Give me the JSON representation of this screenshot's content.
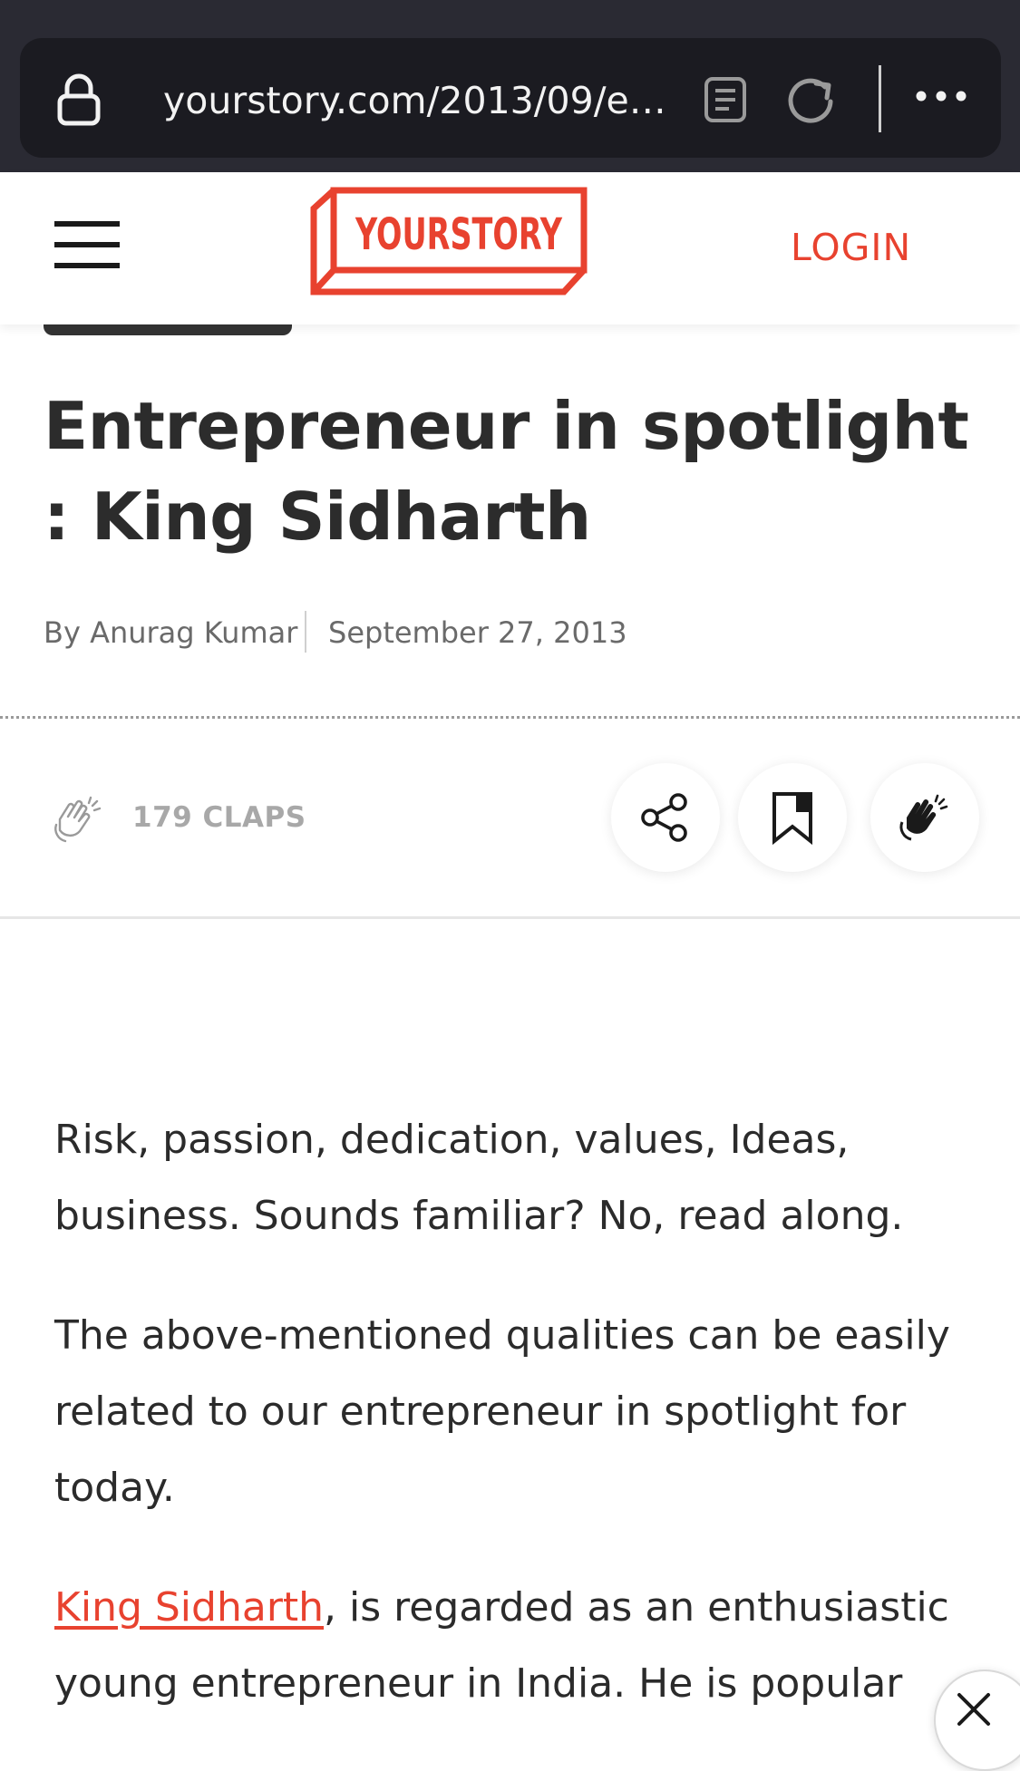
{
  "browser": {
    "url": "yourstory.com/2013/09/ent..."
  },
  "header": {
    "logo_text": "YOURSTORY",
    "login_label": "LOGIN"
  },
  "article": {
    "title": "Entrepreneur in spotlight : King Sidharth",
    "author": "By Anurag Kumar",
    "date": "September 27, 2013",
    "claps_label": "179 CLAPS",
    "paragraphs": [
      "Risk, passion, dedication, values, Ideas, business. Sounds familiar? No, read along.",
      "The above-mentioned qualities can be easily related to our entrepreneur in spotlight for today."
    ],
    "third_paragraph": {
      "link_text": "King Sidharth",
      "rest": ", is regarded as an enthusiastic young entrepreneur in India. He is popular"
    }
  },
  "icons": {
    "lock": "lock-icon",
    "reader": "reader-view-icon",
    "reload": "reload-icon",
    "more": "more-icon",
    "menu": "hamburger-menu-icon",
    "claps": "clapping-hands-icon",
    "share": "share-icon",
    "bookmark": "bookmark-icon",
    "clap_action": "clap-icon",
    "close": "close-icon"
  },
  "colors": {
    "brand": "#e8422f",
    "browser_bar": "#2a2a33",
    "url_pill": "#1b1b21",
    "title_text": "#2c2c2c",
    "meta_text": "#6a6a6a"
  }
}
